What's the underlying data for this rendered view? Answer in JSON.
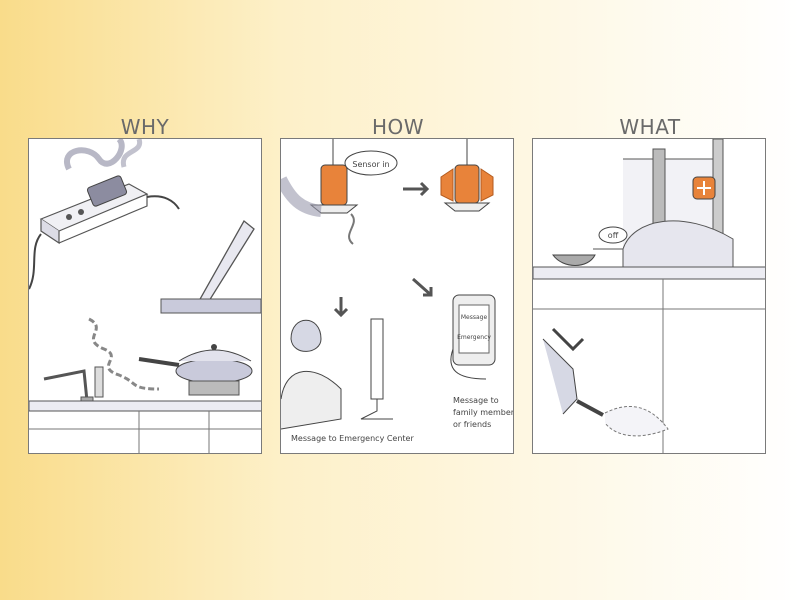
{
  "columns": {
    "why": {
      "title": "WHY"
    },
    "how": {
      "title": "HOW",
      "bubble": "Sensor in",
      "phone_text": [
        "Message",
        "Emergency"
      ],
      "caption_center": "Message to Emergency Center",
      "caption_family": [
        "Message to",
        "family members",
        "or friends"
      ]
    },
    "what": {
      "title": "WHAT",
      "bubble": "off"
    }
  },
  "colors": {
    "accent": "#e8833a",
    "sketch": "#555555",
    "shade": "#b8bcd0",
    "bg_left": "#f9dc8a"
  }
}
